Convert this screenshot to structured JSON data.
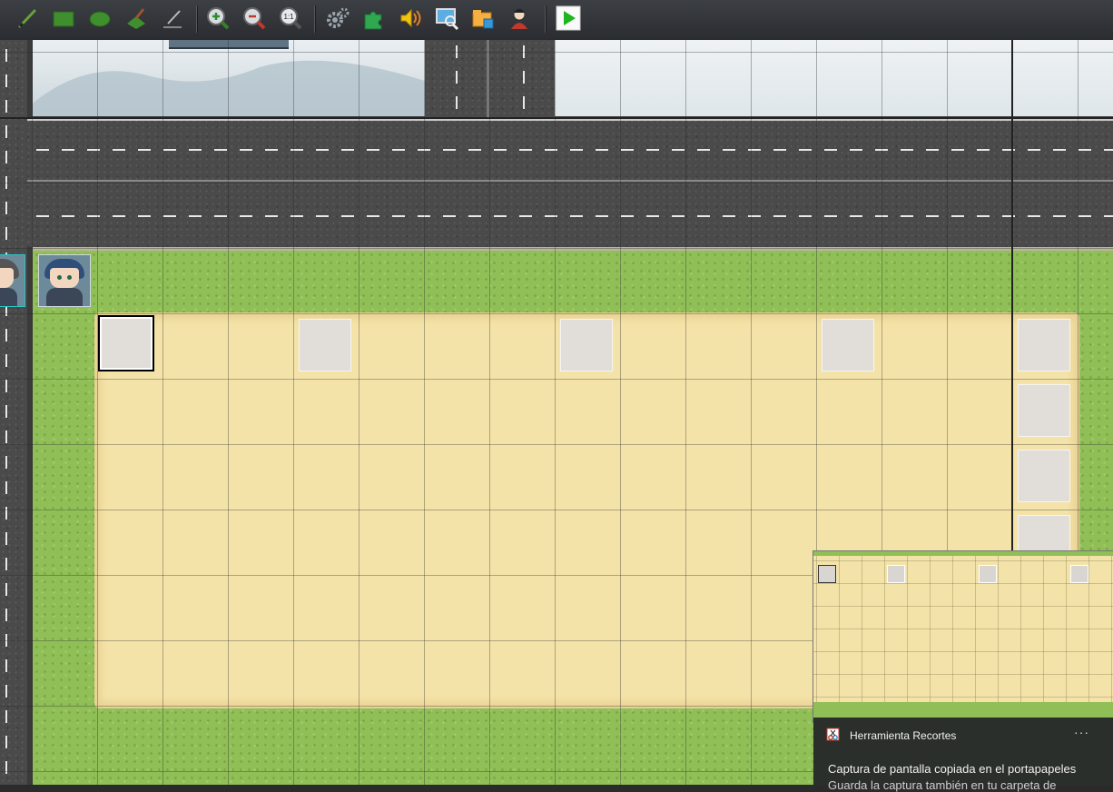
{
  "toolbar": {
    "tools": [
      {
        "name": "pencil-icon"
      },
      {
        "name": "rectangle-icon"
      },
      {
        "name": "ellipse-icon"
      },
      {
        "name": "flood-fill-icon"
      },
      {
        "name": "shadow-pen-icon"
      },
      {
        "name": "zoom-in-icon"
      },
      {
        "name": "zoom-out-icon"
      },
      {
        "name": "zoom-actual-icon",
        "label": "1:1"
      },
      {
        "name": "database-gears-icon"
      },
      {
        "name": "plugin-manager-icon"
      },
      {
        "name": "sound-test-icon"
      },
      {
        "name": "event-searcher-icon"
      },
      {
        "name": "resource-manager-icon"
      },
      {
        "name": "character-generator-icon"
      },
      {
        "name": "playtest-icon"
      }
    ]
  },
  "colors": {
    "toolbar_bg": "#2f3236",
    "grass": "#8fbf56",
    "sand": "#f4e3a8",
    "road": "#4a4a4a",
    "playtest_green": "#1fb51f",
    "toast_bg": "#2b2f2b"
  },
  "notification": {
    "app_name": "Herramienta Recortes",
    "more": "···",
    "message": "Captura de pantalla copiada en el portapapeles",
    "message_cut": "Guarda la captura también en tu carpeta de"
  }
}
